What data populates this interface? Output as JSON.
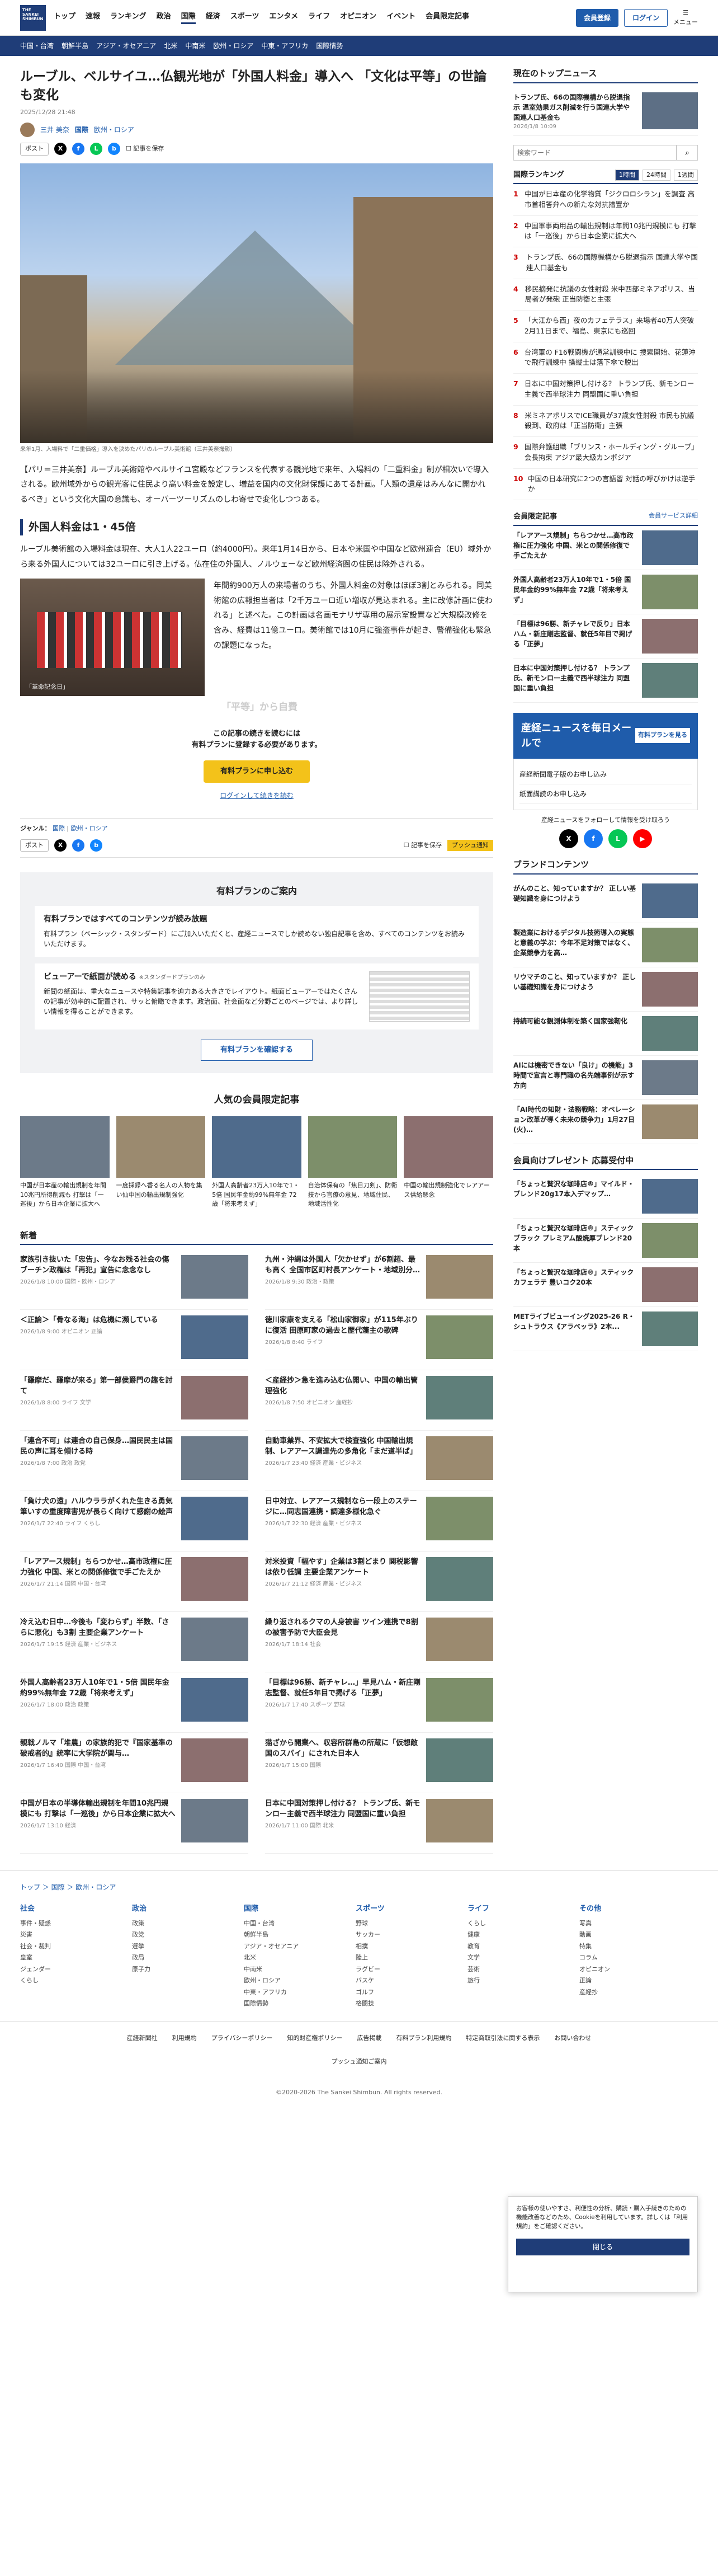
{
  "header": {
    "logo": "THE SANKEI SHIMBUN",
    "nav": [
      "トップ",
      "速報",
      "ランキング",
      "政治",
      "国際",
      "経済",
      "スポーツ",
      "エンタメ",
      "ライフ",
      "オピニオン",
      "イベント",
      "会員限定記事"
    ],
    "active": "国際",
    "subscribe": "会員登録",
    "login": "ログイン",
    "menu": "メニュー"
  },
  "subnav": [
    "中国・台湾",
    "朝鮮半島",
    "アジア・オセアニア",
    "北米",
    "中南米",
    "欧州・ロシア",
    "中東・アフリカ",
    "国際情勢"
  ],
  "article": {
    "title": "ルーブル、ベルサイユ…仏観光地が「外国人料金」導入へ 「文化は平等」の世論も変化",
    "date": "2025/12/28 21:48",
    "author": "三井 美奈",
    "section": "国際",
    "subsection": "欧州・ロシア",
    "post": "ポスト",
    "save": "記事を保存",
    "caption": "来年1月、入場料で「二重価格」導入を決めたパリのルーブル美術館（三井美奈撮影）",
    "lead": "【パリ＝三井美奈】ルーブル美術館やベルサイユ宮殿などフランスを代表する観光地で来年、入場料の「二重料金」制が相次いで導入される。欧州域外からの観光客に住民より高い料金を設定し、増益を国内の文化財保護にあてる計画。「人類の遺産はみんなに開かれるべき」という文化大国の意識も、オーバーツーリズムのしわ寄せで変化しつつある。",
    "h2": "外国人料金は1・45倍",
    "p1": "ルーブル美術館の入場料金は現在、大人1人22ユーロ（約4000円）。来年1月14日から、日本や米国や中国など欧州連合（EU）域外から来る外国人については32ユーロに引き上げる。仏在住の外国人、ノルウェーなど欧州経済圏の住民は除外される。",
    "p2": "年間約900万人の来場者のうち、外国人料金の対象はほぼ3割とみられる。同美術館の広報担当者は「2千万ユーロ近い増収が見込まれる。主に改修計画に使われる」と述べた。この計画は名画モナリザ専用の展示室設置など大規模改修を含み、経費は11億ユーロ。美術館では10月に強盗事件が起き、警備強化も緊急の課題になった。",
    "photo_tag": "「革命記念日」",
    "next_head": "「平等」から自費",
    "paywall1": "この記事の続きを読むには",
    "paywall2": "有料プランに登録する必要があります。",
    "plan_btn": "有料プランに申し込む",
    "login_link": "ログインして続きを読む",
    "genre_label": "ジャンル：",
    "genres": [
      "国際",
      "欧州・ロシア"
    ],
    "pr": "プッシュ通知"
  },
  "plan": {
    "title": "有料プランのご案内",
    "b1t": "有料プランではすべてのコンテンツが読み放題",
    "b1": "有料プラン（ベーシック・スタンダード）にご加入いただくと、産経ニュースでしか読めない独自記事を含め、すべてのコンテンツをお読みいただけます。",
    "b2t": "ビューアーで紙面が読める",
    "b2tag": "※スタンダードプランのみ",
    "b2": "新聞の紙面は、重大なニュースや特集記事を迫力ある大きさでレイアウト。紙面ビューアーではたくさんの記事が効率的に配置され、サッと俯瞰できます。政治面、社会面など分野ごとのページでは、より詳しい情報を得ることができます。",
    "btn": "有料プランを確認する"
  },
  "members": {
    "title": "人気の会員限定記事",
    "items": [
      "中国が日本産の輸出規制を年間10兆円所得削減も 打撃は「一巡後」から日本企業に拡大へ",
      "一度採録へ香る名人の人物を集い仙中国の輸出規制強化",
      "外国人高齢者23万人10年で1・5倍 国民年金約99%無年金 72歳「将来考えず」",
      "自治体保有の「焦日刀剣」、防衛技から官僚の意見、地域住民、地域活性化",
      "中国の輸出規制強化でレアアース供給懸念"
    ]
  },
  "news": {
    "title": "新着",
    "items": [
      {
        "t": "家族引き抜いた「忠告」、今なお残る社会の傷 ブーチン政権は「再犯」宣告に念念なし",
        "m": "2026/1/8 10:00 国際・欧州・ロシア"
      },
      {
        "t": "九州・沖縄は外国人「欠かせず」が6割超、最も高く 全国市区町村長アンケート・地域別分…",
        "m": "2026/1/8 9:30 政治・政策"
      },
      {
        "t": "＜正論＞「骨なる海」は危機に瀕している",
        "m": "2026/1/8 9:00 オピニオン 正論"
      },
      {
        "t": "徳川家康を支える「松山家御家」が115年ぶりに復活 田原町家の過去と歴代藩主の歌碑",
        "m": "2026/1/8 8:40 ライフ"
      },
      {
        "t": "「羅摩だ、羅摩が来る」第一部侯爵門の趣を討て",
        "m": "2026/1/8 8:00 ライフ 文学"
      },
      {
        "t": "＜産経抄＞急を進み込む仏開い、中国の輸出管理強化",
        "m": "2026/1/8 7:50 オピニオン 産経抄"
      },
      {
        "t": "「連合不可」は連合の自己保身…国民民主は国民の声に耳を傾ける時",
        "m": "2026/1/8 7:00 政治 政党"
      },
      {
        "t": "自動車業界、不安拡大で検査強化 中国輸出規制、レアアース調達先の多角化「まだ道半ば」",
        "m": "2026/1/7 23:40 経済 産業・ビジネス"
      },
      {
        "t": "「負け犬の遠」ハルウララがくれた生きる勇気 筆いすの重度障害児が長らく向けて感謝の絵声",
        "m": "2026/1/7 22:40 ライフ くらし"
      },
      {
        "t": "日中対立、レアアース規制なら一段上のステージに…同志国連携・調達多様化急ぐ",
        "m": "2026/1/7 22:30 経済 産業・ビジネス"
      },
      {
        "t": "「レアアース規制」ちらつかせ…高市政権に圧力強化 中国、米との関係修復で手ごたえか",
        "m": "2026/1/7 21:14 国際 中国・台湾"
      },
      {
        "t": "対米投資「幅やす」企業は3割どまり 関税影響は依り低調 主要企業アンケート",
        "m": "2026/1/7 21:12 経済 産業・ビジネス"
      },
      {
        "t": "冷え込む日中…今後も「変わらず」半数、「さらに悪化」も3割 主要企業アンケート",
        "m": "2026/1/7 19:15 経済 産業・ビジネス"
      },
      {
        "t": "繰り返されるクマの人身被害 ツイン連携で8割の被害予防で大臣会見",
        "m": "2026/1/7 18:14 社会"
      },
      {
        "t": "外国人高齢者23万人10年で1・5倍 国民年金約99%無年金 72歳「将来考えず」",
        "m": "2026/1/7 18:00 政治 政策"
      },
      {
        "t": "「目標は96勝、新チャレ…」早見ハム・新庄剛志監督、就任5年目で掲げる「正夢」",
        "m": "2026/1/7 17:40 スポーツ 野球"
      },
      {
        "t": "親戦ノルマ「堆農」の家族的犯で『国家基準の破戒者的』統率に大学院が関与…",
        "m": "2026/1/7 16:40 国際 中国・台湾"
      },
      {
        "t": "猫ざから開業へ、収容所群島の所蔵に「仮想敵国のスパイ」にされた日本人",
        "m": "2026/1/7 15:00 国際"
      },
      {
        "t": "中国が日本の半導体輸出規制を年間10兆円規模にも 打撃は「一巡後」から日本企業に拡大へ",
        "m": "2026/1/7 13:10 経済"
      },
      {
        "t": "日本に中国対策押し付ける？ トランプ氏、新モンロー主義で西半球注力 同盟国に重い負担",
        "m": "2026/1/7 11:00 国際 北米"
      }
    ]
  },
  "side": {
    "topnews_title": "現在のトップニュース",
    "top": "トランプ氏、66の国際機構から脱退指示 温室効果ガス削減を行う国連大学や国連人口基金も",
    "top_m": "2026/1/8 10:09",
    "search_ph": "検索ワード",
    "search_btn": "検索",
    "rank_title": "国際ランキング",
    "rank_tabs": [
      "1時間",
      "24時間",
      "1週間"
    ],
    "rank": [
      "中国が日本産の化学物質「ジクロロシラン」を調査 高市首相答弁への新たな対抗措置か",
      "中国軍事両用品の輸出規制は年間10兆円規模にも 打撃は「一巡後」から日本企業に拡大へ",
      "トランプ氏、66の国際機構から脱退指示 国連大学や国連人口基金も",
      "移民摘発に抗議の女性射殺 米中西部ミネアポリス、当局者が発砲 正当防衛と主張",
      "「大江から西」夜のカフェテラス」来場者40万人突破 2月11日まで、福島、東京にも巡回",
      "台湾軍の F16戦闘機が通常訓練中に 捜索開始、花蓮沖で飛行訓練中 操縦士は落下傘で脱出",
      "日本に中国対策押し付ける？ トランプ氏、新モンロー主義で西半球注力 同盟国に重い負担",
      "米ミネアポリスでICE職員が37歳女性射殺 市民も抗議殺到、政府は「正当防衛」主張",
      "国際弁護組織「ブリンス・ホールディング・グループ」会長拘束 アジア最大級カンボジア",
      "中国の日本研究に2つの言語習 対話の呼びかけは逆手か"
    ],
    "member_title": "会員限定記事",
    "member_more": "会員サービス詳細",
    "member": [
      "「レアアース規制」ちらつかせ…高市政権に圧力強化 中国、米との関係修復で手ごたえか",
      "外国人高齢者23万人10年で1・5倍 国民年金約99%無年金 72歳「将来考えず」",
      "「目標は96勝、新チャレで反り」日本ハム・新庄剛志監督、就任5年目で掲げる「正夢」",
      "日本に中国対策押し付ける？ トランプ氏、新モンロー主義で西半球注力 同盟国に重い負担"
    ],
    "mail_title": "産経ニュースを毎日メールで",
    "mail_btn": "有料プランを見る",
    "svc": [
      "産経新聞電子版のお申し込み",
      "紙面講読のお申し込み"
    ],
    "sns_label": "産経ニュースをフォローして情報を受け取ろう",
    "brand_title": "ブランドコンテンツ",
    "brand": [
      "がんのこと、知っていますか？ 正しい基礎知識を身につけよう",
      "製造業におけるデジタル技術導入の実態と意義の学ぶ：今年不足対策ではなく、企業競争力を高…",
      "リウマチのこと、知っていますか？ 正しい基礎知識を身につけよう",
      "持続可能な観測体制を築く国家強靭化",
      "AIには機密できない「良け」の機能」3時間で宣言と専門職の名先端事例が示す方向",
      "「AI時代の知財・法務戦略：オペレーション改革が導く未来の競争力」1月27日(火)…"
    ],
    "present_title": "会員向けプレゼント 応募受付中",
    "present": [
      "「ちょっと贅沢な珈琲店®」マイルド・ブレンド20g17本入デマップ…",
      "「ちょっと贅沢な珈琲店®」スティックブラック プレミアム酸焼厚ブレンド20本",
      "「ちょっと贅沢な珈琲店®」スティックカフェラテ 豊いコク20本",
      "METライブビューイング2025-26 R・シュトラウス《アラベッラ》2本..."
    ]
  },
  "popup": {
    "text": "お客様の使いやすさ、利便性の分析、購読・購入手続きのための機能改善などのため、Cookieを利用しています。詳しくは「利用規約」をご確認ください。",
    "close": "閉じる"
  },
  "footer": {
    "breadcrumb": [
      "トップ",
      "国際",
      "欧州・ロシア"
    ],
    "cols": [
      {
        "h": "社会",
        "i": [
          "事件・疑惑",
          "災害",
          "社会・裁判",
          "皇室",
          "ジェンダー",
          "くらし"
        ]
      },
      {
        "h": "政治",
        "i": [
          "政策",
          "政党",
          "選挙",
          "政局",
          "原子力"
        ]
      },
      {
        "h": "国際",
        "i": [
          "中国・台湾",
          "朝鮮半島",
          "アジア・オセアニア",
          "北米",
          "中南米",
          "欧州・ロシア",
          "中東・アフリカ",
          "国際情勢"
        ]
      },
      {
        "h": "スポーツ",
        "i": [
          "野球",
          "サッカー",
          "相撲",
          "陸上",
          "ラグビー",
          "バスケ",
          "ゴルフ",
          "格闘技"
        ]
      },
      {
        "h": "ライフ",
        "i": [
          "くらし",
          "健康",
          "教育",
          "文学",
          "芸術",
          "旅行"
        ]
      },
      {
        "h": "その他",
        "i": [
          "写真",
          "動画",
          "特集",
          "コラム",
          "オピニオン",
          "正論",
          "産経抄"
        ]
      }
    ],
    "links": [
      "産経新聞社",
      "利用規約",
      "プライバシーポリシー",
      "知的財産権ポリシー",
      "広告掲載",
      "有料プラン利用規約",
      "特定商取引法に関する表示",
      "お問い合わせ",
      "プッシュ通知ご案内"
    ],
    "copy": "©2020-2026 The Sankei Shimbun. All rights reserved."
  },
  "colors": {
    "brand": "#1f3d78",
    "accent": "#1f5cab",
    "yellow": "#f3c21a"
  }
}
